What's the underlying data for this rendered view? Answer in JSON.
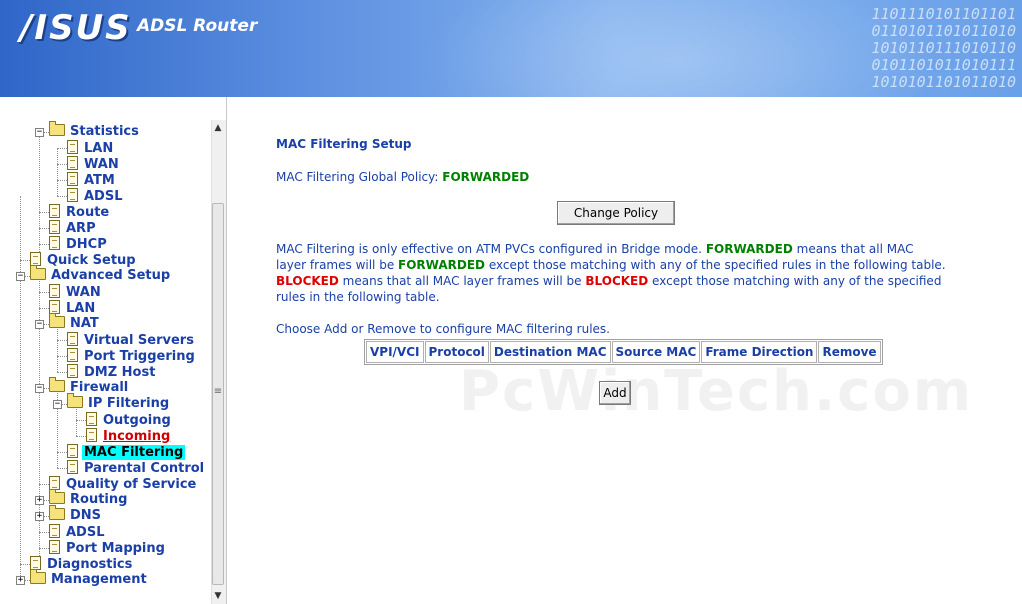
{
  "header": {
    "logo": "/ISUS",
    "subtitle": "ADSL Router",
    "binary_lines": [
      "1101110101101101",
      "0110101101011010",
      "1010110111010110",
      "0101101011010111",
      "1010101101011010"
    ]
  },
  "sidebar": {
    "items": [
      {
        "label": "Statistics",
        "type": "folder",
        "level": 1,
        "expander": "minus"
      },
      {
        "label": "LAN",
        "type": "doc",
        "level": 2
      },
      {
        "label": "WAN",
        "type": "doc",
        "level": 2
      },
      {
        "label": "ATM",
        "type": "doc",
        "level": 2
      },
      {
        "label": "ADSL",
        "type": "doc",
        "level": 2
      },
      {
        "label": "Route",
        "type": "doc",
        "level": 1
      },
      {
        "label": "ARP",
        "type": "doc",
        "level": 1
      },
      {
        "label": "DHCP",
        "type": "doc",
        "level": 1
      },
      {
        "label": "Quick Setup",
        "type": "doc",
        "level": 0
      },
      {
        "label": "Advanced Setup",
        "type": "folder",
        "level": 0,
        "expander": "minus"
      },
      {
        "label": "WAN",
        "type": "doc",
        "level": 1
      },
      {
        "label": "LAN",
        "type": "doc",
        "level": 1
      },
      {
        "label": "NAT",
        "type": "folder",
        "level": 1,
        "expander": "minus"
      },
      {
        "label": "Virtual Servers",
        "type": "doc",
        "level": 2
      },
      {
        "label": "Port Triggering",
        "type": "doc",
        "level": 2
      },
      {
        "label": "DMZ Host",
        "type": "doc",
        "level": 2
      },
      {
        "label": "Firewall",
        "type": "folder",
        "level": 1,
        "expander": "minus"
      },
      {
        "label": "IP Filtering",
        "type": "folder",
        "level": 2,
        "expander": "minus"
      },
      {
        "label": "Outgoing",
        "type": "doc",
        "level": 3
      },
      {
        "label": "Incoming",
        "type": "doc",
        "level": 3,
        "state": "red"
      },
      {
        "label": "MAC Filtering",
        "type": "doc",
        "level": 2,
        "state": "selected"
      },
      {
        "label": "Parental Control",
        "type": "doc",
        "level": 2
      },
      {
        "label": "Quality of Service",
        "type": "doc",
        "level": 1
      },
      {
        "label": "Routing",
        "type": "folder",
        "level": 1,
        "expander": "plus"
      },
      {
        "label": "DNS",
        "type": "folder",
        "level": 1,
        "expander": "plus"
      },
      {
        "label": "ADSL",
        "type": "doc",
        "level": 1
      },
      {
        "label": "Port Mapping",
        "type": "doc",
        "level": 1
      },
      {
        "label": "Diagnostics",
        "type": "doc",
        "level": 0
      },
      {
        "label": "Management",
        "type": "folder",
        "level": 0,
        "expander": "plus"
      }
    ]
  },
  "scrollbar": {
    "up": "▲",
    "down": "▼",
    "grip": "≡"
  },
  "main": {
    "title": "MAC Filtering Setup",
    "policy_label": "MAC Filtering Global Policy:",
    "policy_value": "FORWARDED",
    "change_policy_button": "Change Policy",
    "desc": {
      "p1": "MAC Filtering is only effective on ATM PVCs configured in Bridge mode.",
      "w1": "FORWARDED",
      "p2": "means that all MAC layer frames will be",
      "w2": "FORWARDED",
      "p3": "except those matching with any of the specified rules in the following table.",
      "w3": "BLOCKED",
      "p4": "means that all MAC layer frames will be",
      "w4": "BLOCKED",
      "p5": "except those matching with any of the specified rules in the following table."
    },
    "choose_text": "Choose Add or Remove to configure MAC filtering rules.",
    "table": {
      "columns": [
        "VPI/VCI",
        "Protocol",
        "Destination MAC",
        "Source MAC",
        "Frame Direction",
        "Remove"
      ]
    },
    "add_button": "Add",
    "watermark": "PcWinTech.com"
  }
}
